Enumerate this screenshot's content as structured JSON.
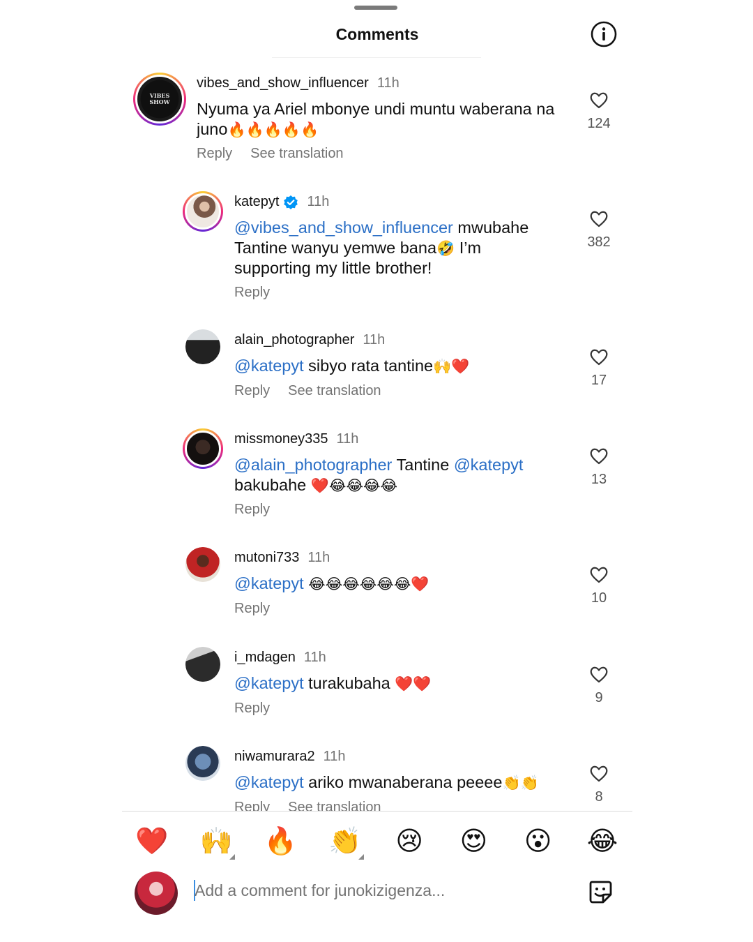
{
  "header": {
    "title": "Comments",
    "info_icon": "info-circle-icon"
  },
  "comments": [
    {
      "username": "vibes_and_show_influencer",
      "time": "11h",
      "verified": false,
      "parts": [
        {
          "t": "Nyuma ya Ariel mbonye undi muntu waberana na juno"
        },
        {
          "t": "🔥🔥🔥🔥🔥",
          "emoji": true
        }
      ],
      "reply_label": "Reply",
      "translation_label": "See translation",
      "likes": "124",
      "avatar_text": "VIBES SHOW"
    },
    {
      "username": "katepyt",
      "time": "11h",
      "verified": true,
      "parts": [
        {
          "t": "@vibes_and_show_influencer",
          "mention": true
        },
        {
          "t": " mwubahe Tantine wanyu yemwe bana"
        },
        {
          "t": "🤣",
          "emoji": true
        },
        {
          "t": " I’m supporting my little brother!"
        }
      ],
      "reply_label": "Reply",
      "likes": "382"
    },
    {
      "username": "alain_photographer",
      "time": "11h",
      "verified": false,
      "parts": [
        {
          "t": "@katepyt",
          "mention": true
        },
        {
          "t": " sibyo rata tantine"
        },
        {
          "t": "🙌❤️",
          "emoji": true
        }
      ],
      "reply_label": "Reply",
      "translation_label": "See translation",
      "likes": "17"
    },
    {
      "username": "missmoney335",
      "time": "11h",
      "verified": false,
      "parts": [
        {
          "t": "@alain_photographer",
          "mention": true
        },
        {
          "t": " Tantine "
        },
        {
          "t": "@katepyt",
          "mention": true
        },
        {
          "t": " bakubahe "
        },
        {
          "t": "❤️😂😂😂😂",
          "emoji": true
        }
      ],
      "reply_label": "Reply",
      "likes": "13"
    },
    {
      "username": "mutoni733",
      "time": "11h",
      "verified": false,
      "parts": [
        {
          "t": "@katepyt",
          "mention": true
        },
        {
          "t": " "
        },
        {
          "t": "😂😂😂😂😂😂❤️",
          "emoji": true
        }
      ],
      "reply_label": "Reply",
      "likes": "10"
    },
    {
      "username": "i_mdagen",
      "time": "11h",
      "verified": false,
      "parts": [
        {
          "t": "@katepyt",
          "mention": true
        },
        {
          "t": " turakubaha "
        },
        {
          "t": "❤️❤️",
          "emoji": true
        }
      ],
      "reply_label": "Reply",
      "likes": "9"
    },
    {
      "username": "niwamurara2",
      "time": "11h",
      "verified": false,
      "parts": [
        {
          "t": "@katepyt",
          "mention": true
        },
        {
          "t": " ariko mwanaberana peeee"
        },
        {
          "t": "👏👏",
          "emoji": true
        }
      ],
      "reply_label": "Reply",
      "translation_label": "See translation",
      "likes": "8"
    }
  ],
  "reactions": [
    "❤️",
    "🙌",
    "🔥",
    "👏",
    "😢",
    "😍",
    "😮",
    "😂"
  ],
  "composer": {
    "placeholder": "Add a comment for junokizigenza...",
    "sticker_icon": "sticker-icon"
  },
  "colors": {
    "mention": "#2b6fc6",
    "muted": "#737373",
    "verified": "#0095f6"
  }
}
